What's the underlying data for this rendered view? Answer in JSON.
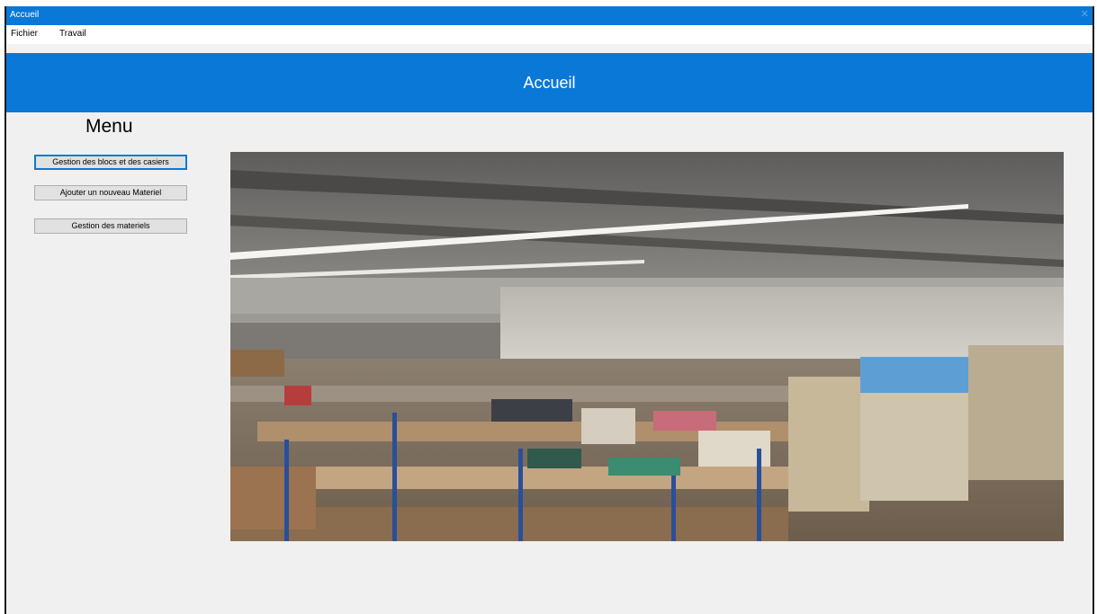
{
  "window": {
    "title": "Accueil",
    "close_glyph": "✕"
  },
  "menubar": {
    "items": [
      "Fichier",
      "Travail"
    ]
  },
  "header": {
    "title": "Accueil"
  },
  "sidebar": {
    "title": "Menu",
    "buttons": [
      "Gestion des blocs et des casiers",
      "Ajouter un nouveau Materiel",
      "Gestion des materiels"
    ]
  },
  "colors": {
    "accent": "#0a78d7",
    "background": "#f0f0f0",
    "button": "#e1e1e1"
  }
}
